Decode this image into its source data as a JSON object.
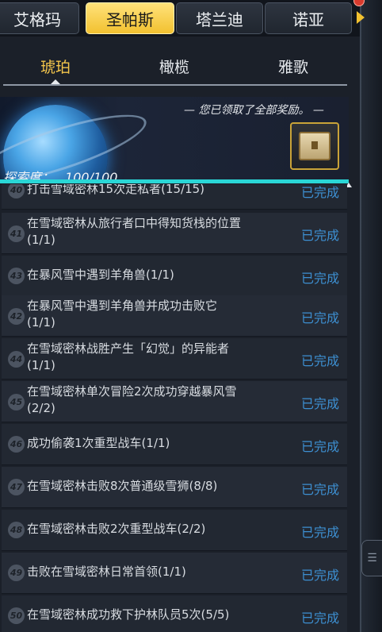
{
  "planet_tabs": [
    {
      "label": "艾格玛",
      "active": false
    },
    {
      "label": "圣帕斯",
      "active": true
    },
    {
      "label": "塔兰迪",
      "active": false
    },
    {
      "label": "诺亚",
      "active": false
    }
  ],
  "region_tabs": [
    {
      "label": "琥珀",
      "active": true
    },
    {
      "label": "橄榄",
      "active": false
    },
    {
      "label": "雅歌",
      "active": false
    }
  ],
  "banner": {
    "reward_note": "— 您已领取了全部奖励。 —",
    "explore_label": "探索度：",
    "explore_value": "100/100",
    "explore_fraction": 1.0
  },
  "colors": {
    "accent_gold": "#f2c130",
    "status_blue": "#3d8fd1",
    "progress_cyan": "#2ad6d6"
  },
  "tasks": [
    {
      "num": "40",
      "text": "打击雪域密林15次走私者(15/15)",
      "status": "已完成"
    },
    {
      "num": "41",
      "text": "在雪域密林从旅行者口中得知货栈的位置",
      "text2": "(1/1)",
      "status": "已完成"
    },
    {
      "num": "43",
      "text": "在暴风雪中遇到羊角兽(1/1)",
      "status": "已完成"
    },
    {
      "num": "42",
      "text": "在暴风雪中遇到羊角兽并成功击败它",
      "text2": "(1/1)",
      "status": "已完成"
    },
    {
      "num": "44",
      "text": "在雪域密林战胜产生「幻觉」的异能者",
      "text2": "(1/1)",
      "status": "已完成"
    },
    {
      "num": "45",
      "text": "在雪域密林单次冒险2次成功穿越暴风雪",
      "text2": "(2/2)",
      "status": "已完成"
    },
    {
      "num": "46",
      "text": "成功偷袭1次重型战车(1/1)",
      "status": "已完成"
    },
    {
      "num": "47",
      "text": "在雪域密林击败8次普通级雪狮(8/8)",
      "status": "已完成"
    },
    {
      "num": "48",
      "text": "在雪域密林击败2次重型战车(2/2)",
      "status": "已完成"
    },
    {
      "num": "49",
      "text": "击败在雪域密林日常首领(1/1)",
      "status": "已完成"
    },
    {
      "num": "50",
      "text": "在雪域密林成功救下护林队员5次(5/5)",
      "status": "已完成"
    }
  ]
}
